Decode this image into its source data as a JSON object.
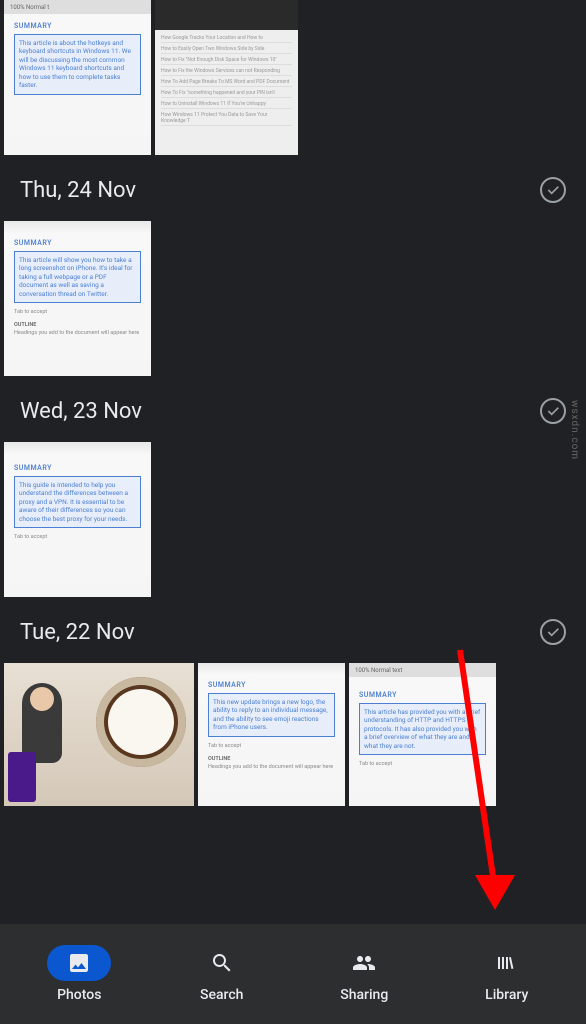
{
  "sections": [
    {
      "date": "Thu, 24 Nov",
      "thumbs": [
        {
          "summary_label": "SUMMARY",
          "box_text": "This article will show you how to take a long screenshot on iPhone. It's ideal for taking a full webpage or a PDF document as well as saving a conversation thread on Twitter.",
          "tab_text": "Tab to accept",
          "outline_label": "OUTLINE",
          "outline_text": "Headings you add to the document will appear here"
        }
      ]
    },
    {
      "date": "Wed, 23 Nov",
      "thumbs": [
        {
          "summary_label": "SUMMARY",
          "box_text": "This guide is intended to help you understand the differences between a proxy and a VPN. It is essential to be aware of their differences so you can choose the best proxy for your needs.",
          "tab_text": "Tab to accept"
        }
      ]
    },
    {
      "date": "Tue, 22 Nov",
      "thumbs": [
        {
          "type": "coffee"
        },
        {
          "summary_label": "SUMMARY",
          "box_text": "This new update brings a new logo, the ability to reply to an individual message, and the ability to see emoji reactions from iPhone users.",
          "tab_text": "Tab to accept",
          "outline_label": "OUTLINE",
          "outline_text": "Headings you add to the document will appear here"
        },
        {
          "summary_label": "SUMMARY",
          "box_text": "This article has provided you with a brief understanding of HTTP and HTTPS protocols. It has also provided you with a brief overview of what they are and what they are not.",
          "tab_text": "Tab to accept",
          "toolbar": "100%   Normal text"
        }
      ]
    }
  ],
  "top_row": {
    "thumb1": {
      "summary_label": "SUMMARY",
      "box_text": "This article is about the hotkeys and keyboard shortcuts in Windows 11. We will be discussing the most common Windows 11 keyboard shortcuts and how to use them to complete tasks faster.",
      "toolbar": "100%   Normal t"
    },
    "thumb2": {
      "lines": [
        "How Google Tracks Your Location and How to",
        "How to Easily Open Two Windows Side by Side",
        "How to Fix \"Not Enough Disk Space for Windows 10\"",
        "How to Fix the Windows Services can not Responding",
        "How To Add Page Breaks To MS Word and PDF Document",
        "How To Fix \"something happened and your PIN isn't",
        "How to Uninstall Windows 11 If You're Unhappy",
        "How Windows 11 Protect You Data to Save Your Knowledge T"
      ]
    }
  },
  "nav": {
    "photos": "Photos",
    "search": "Search",
    "sharing": "Sharing",
    "library": "Library"
  },
  "watermark": "wsxdn.com"
}
